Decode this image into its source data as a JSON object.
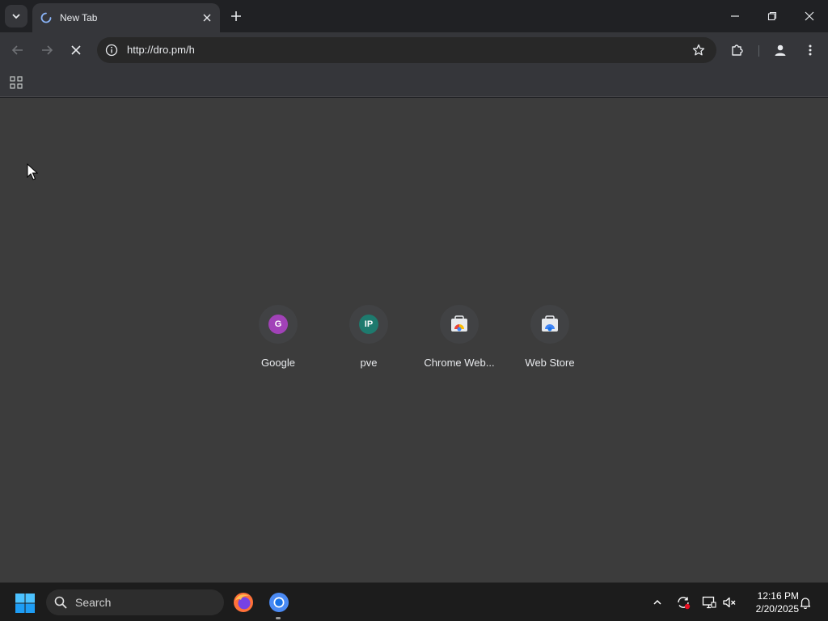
{
  "browser": {
    "tab": {
      "title": "New Tab",
      "state": "loading"
    },
    "address": {
      "url": "http://dro.pm/h"
    },
    "toolbar": {
      "back": "arrow-left-icon",
      "forward": "arrow-right-icon",
      "stop": "close-icon",
      "bookmark": "star-icon",
      "extensions": "puzzle-icon",
      "profile": "person-icon",
      "menu": "more-vert-icon"
    }
  },
  "shortcuts": [
    {
      "label": "Google",
      "badge": "G",
      "badge_color": "#a142b8"
    },
    {
      "label": "pve",
      "badge": "IP",
      "badge_color": "#1e7a6e"
    },
    {
      "label": "Chrome Web...",
      "badge": "",
      "icon": "chrome-web-store-icon"
    },
    {
      "label": "Web Store",
      "badge": "",
      "icon": "chrome-web-store-icon"
    }
  ],
  "taskbar": {
    "search_label": "Search",
    "apps": [
      "firefox-icon",
      "chrome-icon"
    ],
    "clock": {
      "time": "12:16 PM",
      "date": "2/20/2025"
    }
  },
  "colors": {
    "titlebar": "#202124",
    "toolbar": "#35363a",
    "content": "#3c3c3c",
    "taskbar": "#1c1c1c"
  }
}
